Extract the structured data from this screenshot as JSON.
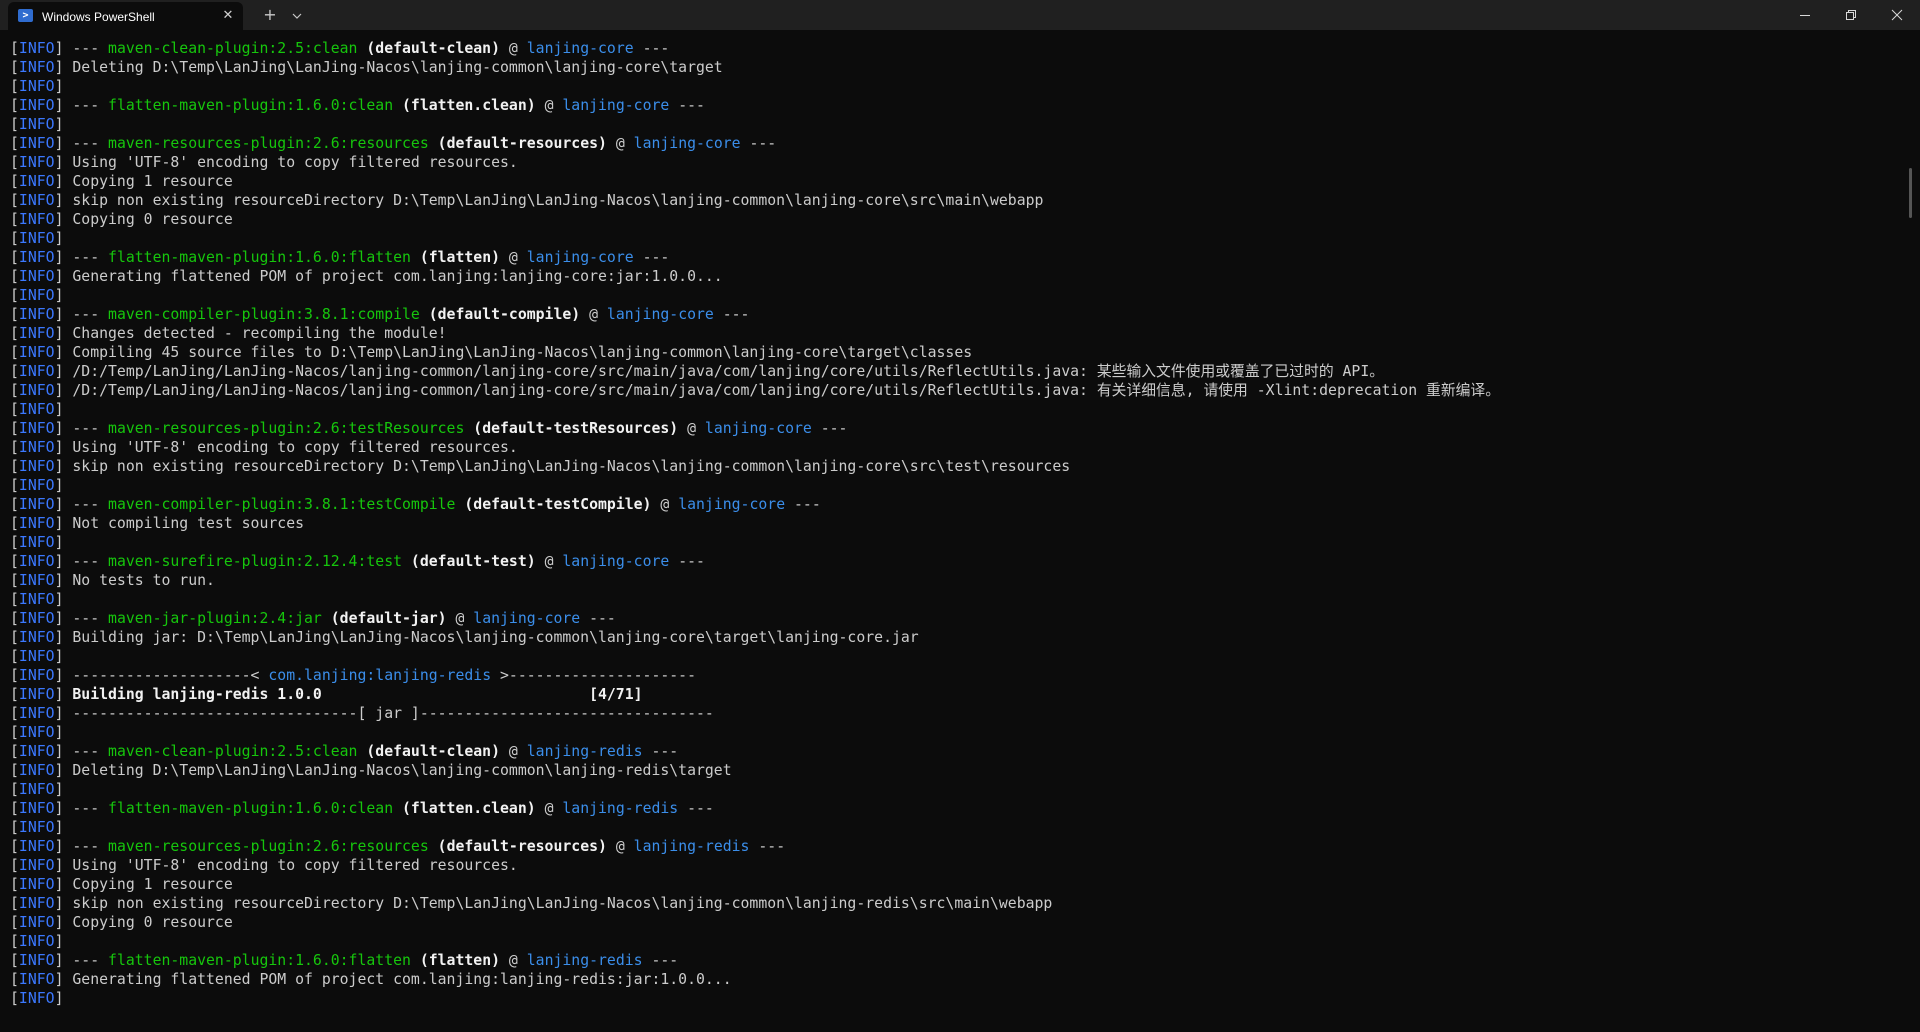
{
  "window": {
    "tab_title": "Windows PowerShell",
    "tab_icon": "powershell-icon",
    "new_tab_icon": "plus-icon",
    "dropdown_icon": "chevron-down-icon"
  },
  "colors": {
    "background": "#0c0c0c",
    "titlebar": "#202020",
    "info": "#3b78ff",
    "plugin": "#16c60c",
    "project": "#3b8eea",
    "text": "#cccccc"
  },
  "terminal": {
    "lines": [
      [
        {
          "t": "info",
          "v": "INFO"
        },
        {
          "t": "text",
          "v": " --- "
        },
        {
          "t": "plugin",
          "v": "maven-clean-plugin:2.5:clean"
        },
        {
          "t": "bold",
          "v": " (default-clean)"
        },
        {
          "t": "text",
          "v": " @ "
        },
        {
          "t": "project",
          "v": "lanjing-core"
        },
        {
          "t": "text",
          "v": " ---"
        }
      ],
      [
        {
          "t": "info",
          "v": "INFO"
        },
        {
          "t": "text",
          "v": " Deleting D:\\Temp\\LanJing\\LanJing-Nacos\\lanjing-common\\lanjing-core\\target"
        }
      ],
      [
        {
          "t": "info",
          "v": "INFO"
        }
      ],
      [
        {
          "t": "info",
          "v": "INFO"
        },
        {
          "t": "text",
          "v": " --- "
        },
        {
          "t": "plugin",
          "v": "flatten-maven-plugin:1.6.0:clean"
        },
        {
          "t": "bold",
          "v": " (flatten.clean)"
        },
        {
          "t": "text",
          "v": " @ "
        },
        {
          "t": "project",
          "v": "lanjing-core"
        },
        {
          "t": "text",
          "v": " ---"
        }
      ],
      [
        {
          "t": "info",
          "v": "INFO"
        }
      ],
      [
        {
          "t": "info",
          "v": "INFO"
        },
        {
          "t": "text",
          "v": " --- "
        },
        {
          "t": "plugin",
          "v": "maven-resources-plugin:2.6:resources"
        },
        {
          "t": "bold",
          "v": " (default-resources)"
        },
        {
          "t": "text",
          "v": " @ "
        },
        {
          "t": "project",
          "v": "lanjing-core"
        },
        {
          "t": "text",
          "v": " ---"
        }
      ],
      [
        {
          "t": "info",
          "v": "INFO"
        },
        {
          "t": "text",
          "v": " Using 'UTF-8' encoding to copy filtered resources."
        }
      ],
      [
        {
          "t": "info",
          "v": "INFO"
        },
        {
          "t": "text",
          "v": " Copying 1 resource"
        }
      ],
      [
        {
          "t": "info",
          "v": "INFO"
        },
        {
          "t": "text",
          "v": " skip non existing resourceDirectory D:\\Temp\\LanJing\\LanJing-Nacos\\lanjing-common\\lanjing-core\\src\\main\\webapp"
        }
      ],
      [
        {
          "t": "info",
          "v": "INFO"
        },
        {
          "t": "text",
          "v": " Copying 0 resource"
        }
      ],
      [
        {
          "t": "info",
          "v": "INFO"
        }
      ],
      [
        {
          "t": "info",
          "v": "INFO"
        },
        {
          "t": "text",
          "v": " --- "
        },
        {
          "t": "plugin",
          "v": "flatten-maven-plugin:1.6.0:flatten"
        },
        {
          "t": "bold",
          "v": " (flatten)"
        },
        {
          "t": "text",
          "v": " @ "
        },
        {
          "t": "project",
          "v": "lanjing-core"
        },
        {
          "t": "text",
          "v": " ---"
        }
      ],
      [
        {
          "t": "info",
          "v": "INFO"
        },
        {
          "t": "text",
          "v": " Generating flattened POM of project com.lanjing:lanjing-core:jar:1.0.0..."
        }
      ],
      [
        {
          "t": "info",
          "v": "INFO"
        }
      ],
      [
        {
          "t": "info",
          "v": "INFO"
        },
        {
          "t": "text",
          "v": " --- "
        },
        {
          "t": "plugin",
          "v": "maven-compiler-plugin:3.8.1:compile"
        },
        {
          "t": "bold",
          "v": " (default-compile)"
        },
        {
          "t": "text",
          "v": " @ "
        },
        {
          "t": "project",
          "v": "lanjing-core"
        },
        {
          "t": "text",
          "v": " ---"
        }
      ],
      [
        {
          "t": "info",
          "v": "INFO"
        },
        {
          "t": "text",
          "v": " Changes detected - recompiling the module!"
        }
      ],
      [
        {
          "t": "info",
          "v": "INFO"
        },
        {
          "t": "text",
          "v": " Compiling 45 source files to D:\\Temp\\LanJing\\LanJing-Nacos\\lanjing-common\\lanjing-core\\target\\classes"
        }
      ],
      [
        {
          "t": "info",
          "v": "INFO"
        },
        {
          "t": "text",
          "v": " /D:/Temp/LanJing/LanJing-Nacos/lanjing-common/lanjing-core/src/main/java/com/lanjing/core/utils/ReflectUtils.java: 某些输入文件使用或覆盖了已过时的 API。"
        }
      ],
      [
        {
          "t": "info",
          "v": "INFO"
        },
        {
          "t": "text",
          "v": " /D:/Temp/LanJing/LanJing-Nacos/lanjing-common/lanjing-core/src/main/java/com/lanjing/core/utils/ReflectUtils.java: 有关详细信息, 请使用 -Xlint:deprecation 重新编译。"
        }
      ],
      [
        {
          "t": "info",
          "v": "INFO"
        }
      ],
      [
        {
          "t": "info",
          "v": "INFO"
        },
        {
          "t": "text",
          "v": " --- "
        },
        {
          "t": "plugin",
          "v": "maven-resources-plugin:2.6:testResources"
        },
        {
          "t": "bold",
          "v": " (default-testResources)"
        },
        {
          "t": "text",
          "v": " @ "
        },
        {
          "t": "project",
          "v": "lanjing-core"
        },
        {
          "t": "text",
          "v": " ---"
        }
      ],
      [
        {
          "t": "info",
          "v": "INFO"
        },
        {
          "t": "text",
          "v": " Using 'UTF-8' encoding to copy filtered resources."
        }
      ],
      [
        {
          "t": "info",
          "v": "INFO"
        },
        {
          "t": "text",
          "v": " skip non existing resourceDirectory D:\\Temp\\LanJing\\LanJing-Nacos\\lanjing-common\\lanjing-core\\src\\test\\resources"
        }
      ],
      [
        {
          "t": "info",
          "v": "INFO"
        }
      ],
      [
        {
          "t": "info",
          "v": "INFO"
        },
        {
          "t": "text",
          "v": " --- "
        },
        {
          "t": "plugin",
          "v": "maven-compiler-plugin:3.8.1:testCompile"
        },
        {
          "t": "bold",
          "v": " (default-testCompile)"
        },
        {
          "t": "text",
          "v": " @ "
        },
        {
          "t": "project",
          "v": "lanjing-core"
        },
        {
          "t": "text",
          "v": " ---"
        }
      ],
      [
        {
          "t": "info",
          "v": "INFO"
        },
        {
          "t": "text",
          "v": " Not compiling test sources"
        }
      ],
      [
        {
          "t": "info",
          "v": "INFO"
        }
      ],
      [
        {
          "t": "info",
          "v": "INFO"
        },
        {
          "t": "text",
          "v": " --- "
        },
        {
          "t": "plugin",
          "v": "maven-surefire-plugin:2.12.4:test"
        },
        {
          "t": "bold",
          "v": " (default-test)"
        },
        {
          "t": "text",
          "v": " @ "
        },
        {
          "t": "project",
          "v": "lanjing-core"
        },
        {
          "t": "text",
          "v": " ---"
        }
      ],
      [
        {
          "t": "info",
          "v": "INFO"
        },
        {
          "t": "text",
          "v": " No tests to run."
        }
      ],
      [
        {
          "t": "info",
          "v": "INFO"
        }
      ],
      [
        {
          "t": "info",
          "v": "INFO"
        },
        {
          "t": "text",
          "v": " --- "
        },
        {
          "t": "plugin",
          "v": "maven-jar-plugin:2.4:jar"
        },
        {
          "t": "bold",
          "v": " (default-jar)"
        },
        {
          "t": "text",
          "v": " @ "
        },
        {
          "t": "project",
          "v": "lanjing-core"
        },
        {
          "t": "text",
          "v": " ---"
        }
      ],
      [
        {
          "t": "info",
          "v": "INFO"
        },
        {
          "t": "text",
          "v": " Building jar: D:\\Temp\\LanJing\\LanJing-Nacos\\lanjing-common\\lanjing-core\\target\\lanjing-core.jar"
        }
      ],
      [
        {
          "t": "info",
          "v": "INFO"
        }
      ],
      [
        {
          "t": "info",
          "v": "INFO"
        },
        {
          "t": "text",
          "v": " --------------------< "
        },
        {
          "t": "project",
          "v": "com.lanjing:lanjing-redis"
        },
        {
          "t": "text",
          "v": " >---------------------"
        }
      ],
      [
        {
          "t": "info",
          "v": "INFO"
        },
        {
          "t": "bold",
          "v": " Building lanjing-redis 1.0.0                              [4/71]"
        }
      ],
      [
        {
          "t": "info",
          "v": "INFO"
        },
        {
          "t": "text",
          "v": " --------------------------------[ jar ]---------------------------------"
        }
      ],
      [
        {
          "t": "info",
          "v": "INFO"
        }
      ],
      [
        {
          "t": "info",
          "v": "INFO"
        },
        {
          "t": "text",
          "v": " --- "
        },
        {
          "t": "plugin",
          "v": "maven-clean-plugin:2.5:clean"
        },
        {
          "t": "bold",
          "v": " (default-clean)"
        },
        {
          "t": "text",
          "v": " @ "
        },
        {
          "t": "project",
          "v": "lanjing-redis"
        },
        {
          "t": "text",
          "v": " ---"
        }
      ],
      [
        {
          "t": "info",
          "v": "INFO"
        },
        {
          "t": "text",
          "v": " Deleting D:\\Temp\\LanJing\\LanJing-Nacos\\lanjing-common\\lanjing-redis\\target"
        }
      ],
      [
        {
          "t": "info",
          "v": "INFO"
        }
      ],
      [
        {
          "t": "info",
          "v": "INFO"
        },
        {
          "t": "text",
          "v": " --- "
        },
        {
          "t": "plugin",
          "v": "flatten-maven-plugin:1.6.0:clean"
        },
        {
          "t": "bold",
          "v": " (flatten.clean)"
        },
        {
          "t": "text",
          "v": " @ "
        },
        {
          "t": "project",
          "v": "lanjing-redis"
        },
        {
          "t": "text",
          "v": " ---"
        }
      ],
      [
        {
          "t": "info",
          "v": "INFO"
        }
      ],
      [
        {
          "t": "info",
          "v": "INFO"
        },
        {
          "t": "text",
          "v": " --- "
        },
        {
          "t": "plugin",
          "v": "maven-resources-plugin:2.6:resources"
        },
        {
          "t": "bold",
          "v": " (default-resources)"
        },
        {
          "t": "text",
          "v": " @ "
        },
        {
          "t": "project",
          "v": "lanjing-redis"
        },
        {
          "t": "text",
          "v": " ---"
        }
      ],
      [
        {
          "t": "info",
          "v": "INFO"
        },
        {
          "t": "text",
          "v": " Using 'UTF-8' encoding to copy filtered resources."
        }
      ],
      [
        {
          "t": "info",
          "v": "INFO"
        },
        {
          "t": "text",
          "v": " Copying 1 resource"
        }
      ],
      [
        {
          "t": "info",
          "v": "INFO"
        },
        {
          "t": "text",
          "v": " skip non existing resourceDirectory D:\\Temp\\LanJing\\LanJing-Nacos\\lanjing-common\\lanjing-redis\\src\\main\\webapp"
        }
      ],
      [
        {
          "t": "info",
          "v": "INFO"
        },
        {
          "t": "text",
          "v": " Copying 0 resource"
        }
      ],
      [
        {
          "t": "info",
          "v": "INFO"
        }
      ],
      [
        {
          "t": "info",
          "v": "INFO"
        },
        {
          "t": "text",
          "v": " --- "
        },
        {
          "t": "plugin",
          "v": "flatten-maven-plugin:1.6.0:flatten"
        },
        {
          "t": "bold",
          "v": " (flatten)"
        },
        {
          "t": "text",
          "v": " @ "
        },
        {
          "t": "project",
          "v": "lanjing-redis"
        },
        {
          "t": "text",
          "v": " ---"
        }
      ],
      [
        {
          "t": "info",
          "v": "INFO"
        },
        {
          "t": "text",
          "v": " Generating flattened POM of project com.lanjing:lanjing-redis:jar:1.0.0..."
        }
      ],
      [
        {
          "t": "info",
          "v": "INFO"
        }
      ]
    ]
  }
}
